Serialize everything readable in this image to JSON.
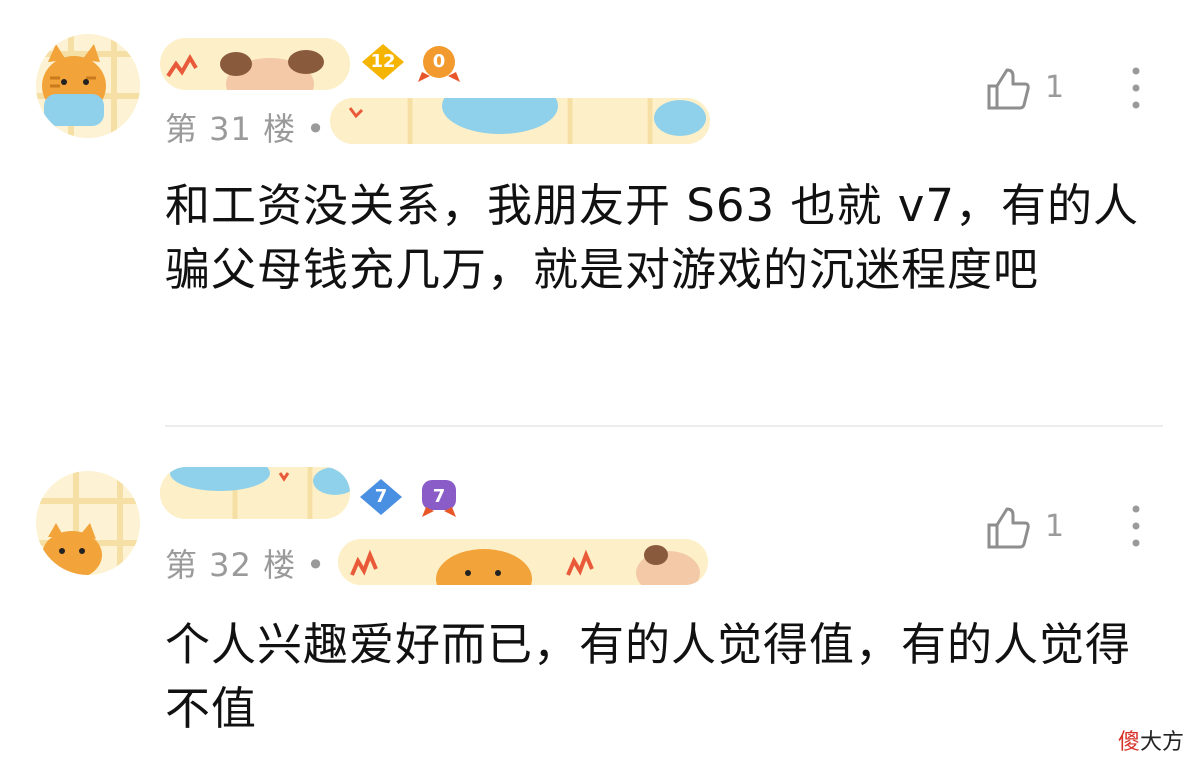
{
  "comments": [
    {
      "floor_label": "第 31 楼",
      "separator": "•",
      "badges": [
        "12",
        "0"
      ],
      "like_count": "1",
      "text": "和工资没关系，我朋友开 S63 也就 v7，有的人骗父母钱充几万，就是对游戏的沉迷程度吧",
      "icons": {
        "like": "thumbs-up-icon",
        "more": "more-vertical-icon"
      }
    },
    {
      "floor_label": "第 32 楼",
      "separator": "•",
      "badges": [
        "7",
        "7"
      ],
      "like_count": "1",
      "text": "个人兴趣爱好而已，有的人觉得值，有的人觉得不值",
      "icons": {
        "like": "thumbs-up-icon",
        "more": "more-vertical-icon"
      }
    }
  ],
  "watermark": {
    "part1": "傻",
    "part2": "大方"
  },
  "colors": {
    "sticker_bg": "#fdf0c8",
    "cat_orange": "#f2a33a",
    "mask_blue": "#8fd0ea",
    "badge_gold": "#f4b400",
    "badge_blue": "#4a90e2",
    "badge_purple": "#8a5cc7"
  }
}
